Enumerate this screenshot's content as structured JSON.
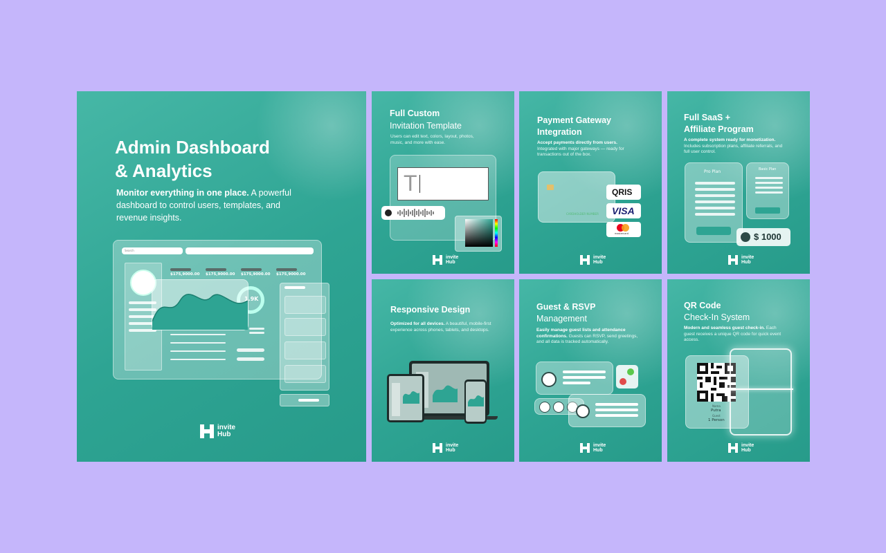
{
  "brand": {
    "line1": "invite",
    "line2": "Hub"
  },
  "dashboard": {
    "title_line1": "Admin Dashboard",
    "title_line2": "& Analytics",
    "desc_bold": "Monitor everything in one place.",
    "desc_rest": " A powerful dashboard to control users, templates, and revenue insights.",
    "search_placeholder": "Search",
    "stats": [
      "$175,9000.00",
      "$175,9000.00",
      "$175,9000.00",
      "$175,9000.00"
    ],
    "donut_value": "1.9K"
  },
  "custom": {
    "title": "Full Custom",
    "subtitle": "Invitation Template",
    "desc": "Users can edit text, colors, layout, photos, music, and more with ease.",
    "text_glyph": "T"
  },
  "payment": {
    "title_line1": "Payment Gateway",
    "title_line2": "Integration",
    "desc_bold": "Accept payments directly from users.",
    "desc_rest": " Integrated with major gateways — ready for transactions out of the box.",
    "card_text": "CARDHOLDER NUMBER",
    "logos": [
      "QRIS",
      "VISA",
      "mastercard"
    ]
  },
  "saas": {
    "title_line1": "Full SaaS +",
    "title_line2": "Affiliate Program",
    "desc_bold": "A complete system ready for monetization.",
    "desc_rest": " Includes subscription plans, affiliate referrals, and full user control.",
    "plan_pro": "Pro Plan",
    "plan_basic": "Basic Plan",
    "amount": "$ 1000"
  },
  "responsive": {
    "title": "Responsive Design",
    "desc_bold": "Optimized for all devices.",
    "desc_rest": " A beautiful, mobile-first experience across phones, tablets, and desktops."
  },
  "rsvp": {
    "title": "Guest & RSVP",
    "subtitle": "Management",
    "desc_bold": "Easily manage guest lists and attendance confirmations.",
    "desc_rest": " Guests can RSVP, send greetings, and all data is tracked automatically."
  },
  "qr": {
    "title": "QR Code",
    "subtitle": "Check-In System",
    "desc_bold": "Modern and seamless guest check-in.",
    "desc_rest": " Each guest receives a unique QR code for quick event access.",
    "name_label": "Nama",
    "name_value": "Putra",
    "guest_label": "Guest",
    "guest_value": "1 Person"
  },
  "colors": {
    "background": "#c5b6fb",
    "card": "#2ea493",
    "accent": "#3fb3a1"
  }
}
